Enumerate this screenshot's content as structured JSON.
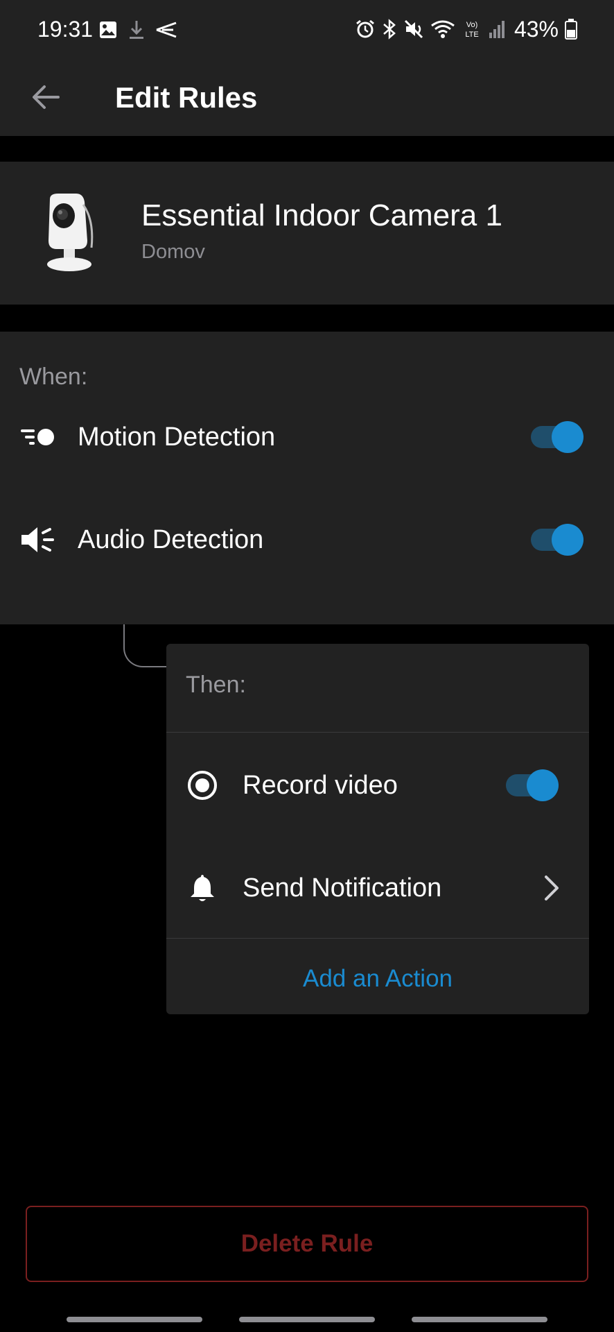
{
  "status_bar": {
    "time": "19:31",
    "battery": "43%",
    "icons_left": [
      "gallery-icon",
      "download-icon",
      "app-icon"
    ],
    "icons_right": [
      "alarm-icon",
      "bluetooth-icon",
      "mute-icon",
      "wifi-icon",
      "volte-icon",
      "signal-icon",
      "battery-icon"
    ]
  },
  "header": {
    "title": "Edit Rules",
    "back_icon": "back-arrow-icon"
  },
  "device": {
    "name": "Essential Indoor Camera 1",
    "location": "Domov",
    "image_icon": "camera-image"
  },
  "when": {
    "label": "When:",
    "triggers": [
      {
        "label": "Motion Detection",
        "icon": "motion-icon",
        "enabled": true
      },
      {
        "label": "Audio Detection",
        "icon": "audio-icon",
        "enabled": true
      }
    ]
  },
  "then": {
    "label": "Then:",
    "actions": [
      {
        "label": "Record video",
        "icon": "record-icon",
        "enabled": true
      },
      {
        "label": "Send Notification",
        "icon": "bell-icon",
        "chevron": "chevron-right-icon"
      }
    ],
    "add_action_label": "Add an Action"
  },
  "delete_label": "Delete Rule",
  "colors": {
    "background": "#000000",
    "surface": "#222222",
    "accent": "#1a8bd0",
    "toggle_track": "#1f4e6b",
    "danger": "#7a1f1f",
    "muted_text": "#9a9a9f"
  }
}
